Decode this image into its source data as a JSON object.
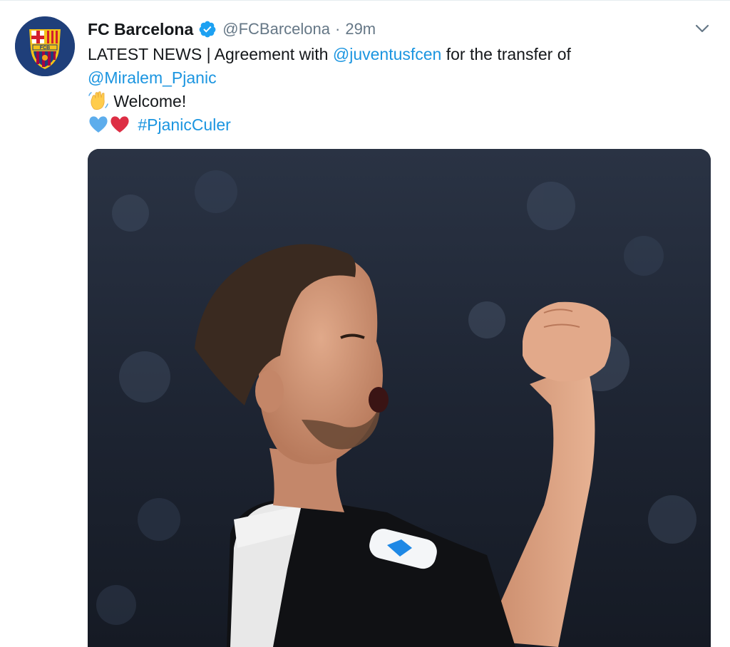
{
  "tweet": {
    "display_name": "FC Barcelona",
    "handle": "@FCBarcelona",
    "separator": "·",
    "timestamp": "29m",
    "text_line1_prefix": "LATEST NEWS | Agreement with ",
    "text_line1_mention": "@juventusfcen",
    "text_line1_suffix": " for the transfer of",
    "text_line2_mention": "@Miralem_Pjanic",
    "text_line3": "Welcome!",
    "hashtag": "#PjanicCuler",
    "crest_letters": "FCB"
  },
  "colors": {
    "link": "#1b95e0",
    "verified": "#1da1f2",
    "secondary_text": "#657786",
    "heart_blue": "#5dadec",
    "heart_red": "#dd2e44"
  },
  "icons": [
    "verified-badge-icon",
    "chevron-down-icon",
    "waving-hand-icon",
    "blue-heart-icon",
    "red-heart-icon"
  ]
}
